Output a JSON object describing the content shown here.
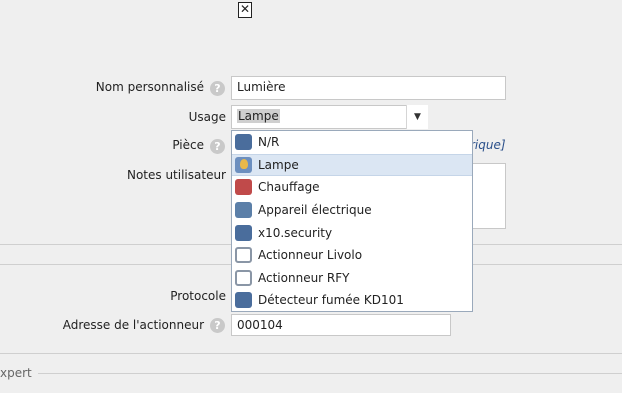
{
  "close_glyph": "✕",
  "form": {
    "nom_label": "Nom personnalisé",
    "nom_value": "Lumière",
    "usage_label": "Usage",
    "usage_value": "Lampe",
    "piece_label": "Pièce",
    "piece_hint": "rique]",
    "notes_label": "Notes utilisateur",
    "protocole_label": "Protocole",
    "adresse_label": "Adresse de l'actionneur",
    "adresse_value": "000104",
    "help_glyph": "?"
  },
  "dropdown": {
    "items": [
      {
        "label": "N/R",
        "icon": "blank-icon",
        "color": "#4a6d9c",
        "selected": false
      },
      {
        "label": "Lampe",
        "icon": "lamp-icon",
        "color": "#e8b84a",
        "selected": true
      },
      {
        "label": "Chauffage",
        "icon": "radiator-icon",
        "color": "#c04a4a",
        "selected": false
      },
      {
        "label": "Appareil électrique",
        "icon": "plug-icon",
        "color": "#5b7fa8",
        "selected": false
      },
      {
        "label": "x10.security",
        "icon": "security-icon",
        "color": "#4a6d9c",
        "selected": false
      },
      {
        "label": "Actionneur Livolo",
        "icon": "livolo-switch-icon",
        "color": "#8a96a6",
        "selected": false
      },
      {
        "label": "Actionneur RFY",
        "icon": "rfy-switch-icon",
        "color": "#8a96a6",
        "selected": false
      },
      {
        "label": "Détecteur fumée KD101",
        "icon": "smoke-detector-icon",
        "color": "#4a6d9c",
        "selected": false
      }
    ]
  },
  "section": {
    "expert_label": "xpert"
  }
}
